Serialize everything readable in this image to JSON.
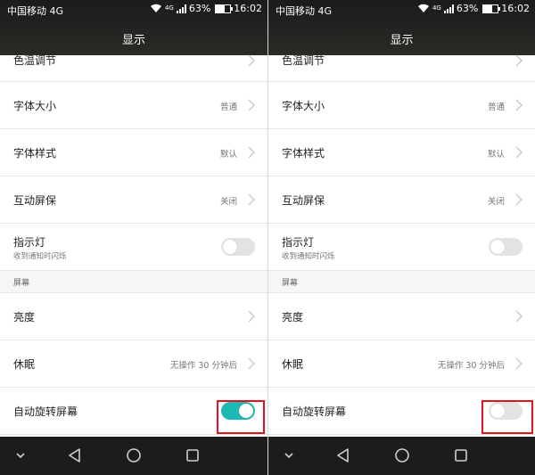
{
  "status": {
    "carrier": "中国移动 4G",
    "signal_4g": "4G",
    "battery": "63%",
    "time": "16:02",
    "battery_level": 0.63
  },
  "title": "显示",
  "rows": {
    "color_temp": "色温调节",
    "font_size": "字体大小",
    "font_size_value": "普通",
    "font_style": "字体样式",
    "font_style_value": "默认",
    "screensaver": "互动屏保",
    "screensaver_value": "关闭",
    "indicator": "指示灯",
    "indicator_sub": "收到通知时闪烁",
    "section_screen": "屏幕",
    "brightness": "亮度",
    "sleep": "休眠",
    "sleep_value": "无操作 30 分钟后",
    "auto_rotate": "自动旋转屏幕"
  },
  "toggles": {
    "indicator": false,
    "auto_rotate_left": true,
    "auto_rotate_right": false
  },
  "colors": {
    "toggle_on": "#1fb9b5",
    "highlight": "#e0141e",
    "bar": "#1c1c1c"
  },
  "icons": [
    "chevron-right-icon",
    "back-icon",
    "home-icon",
    "recents-icon",
    "notification-pull-icon",
    "wifi-icon",
    "signal-icon",
    "battery-icon"
  ]
}
